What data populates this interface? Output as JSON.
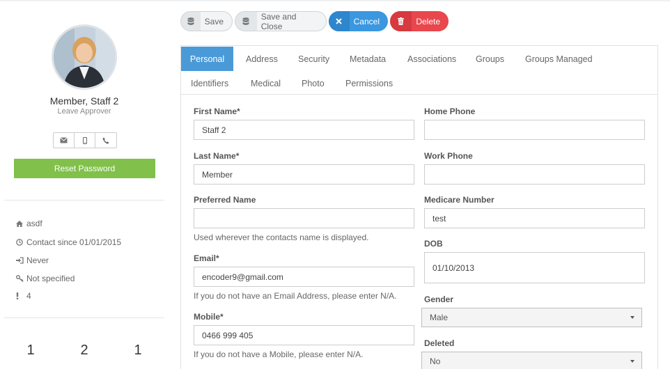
{
  "profile": {
    "name": "Member, Staff 2",
    "role": "Leave Approver",
    "reset_label": "Reset Password",
    "info": {
      "location": "asdf",
      "contact_since": "Contact since 01/01/2015",
      "last_login": "Never",
      "key": "Not specified",
      "alerts": "4"
    },
    "stats": [
      "1",
      "2",
      "1"
    ]
  },
  "toolbar": {
    "save_label": "Save",
    "save_close_label": "Save and Close",
    "cancel_label": "Cancel",
    "delete_label": "Delete"
  },
  "tabs": [
    "Personal",
    "Address",
    "Security",
    "Metadata",
    "Associations",
    "Groups",
    "Groups Managed",
    "Identifiers",
    "Medical",
    "Photo",
    "Permissions"
  ],
  "active_tab": "Personal",
  "form": {
    "first_name": {
      "label": "First Name*",
      "value": "Staff 2"
    },
    "last_name": {
      "label": "Last Name*",
      "value": "Member"
    },
    "preferred_name": {
      "label": "Preferred Name",
      "value": "",
      "help": "Used wherever the contacts name is displayed."
    },
    "email": {
      "label": "Email*",
      "value": "encoder9@gmail.com",
      "help": "If you do not have an Email Address, please enter N/A."
    },
    "mobile": {
      "label": "Mobile*",
      "value": "0466 999 405",
      "help": "If you do not have a Mobile, please enter N/A."
    },
    "home_phone": {
      "label": "Home Phone",
      "value": ""
    },
    "work_phone": {
      "label": "Work Phone",
      "value": ""
    },
    "medicare": {
      "label": "Medicare Number",
      "value": "test"
    },
    "dob": {
      "label": "DOB",
      "value": "01/10/2013"
    },
    "gender": {
      "label": "Gender",
      "value": "Male"
    },
    "deleted": {
      "label": "Deleted",
      "value": "No"
    }
  },
  "colors": {
    "active_tab": "#4a9ad8",
    "reset_button": "#81c04a",
    "cancel_button": "#3a97e0",
    "delete_button": "#e8474d"
  },
  "icons": {
    "save": "database-icon",
    "cancel": "close-icon",
    "delete": "trash-icon",
    "contact": [
      "envelope-icon",
      "mobile-icon",
      "phone-icon"
    ],
    "info": [
      "home-icon",
      "clock-icon",
      "sign-in-icon",
      "key-icon",
      "exclamation-icon"
    ]
  }
}
